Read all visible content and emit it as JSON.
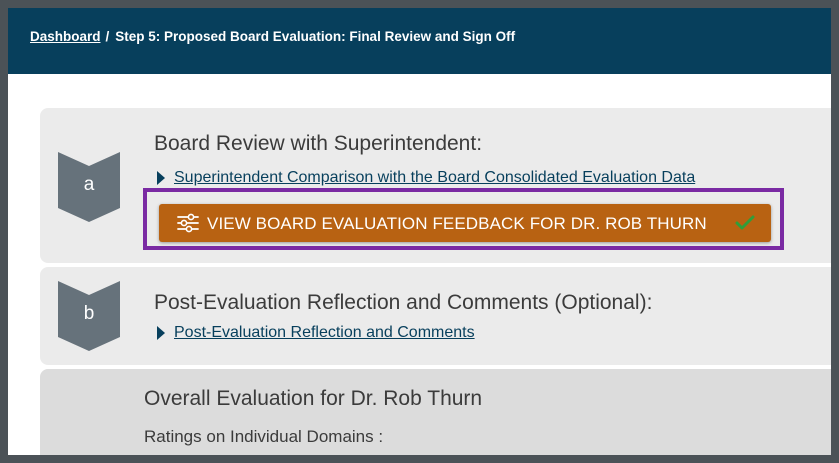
{
  "breadcrumb": {
    "home": "Dashboard",
    "separator": "/",
    "current": "Step 5: Proposed Board Evaluation: Final Review and Sign Off"
  },
  "sections": [
    {
      "badge": "a",
      "title": "Board Review with Superintendent:",
      "link": "Superintendent Comparison with the Board Consolidated Evaluation Data",
      "button": "VIEW BOARD EVALUATION FEEDBACK FOR DR. ROB THURN",
      "button_icon": "sliders-icon",
      "button_status_icon": "check-icon"
    },
    {
      "badge": "b",
      "title": "Post-Evaluation Reflection and Comments (Optional):",
      "link": "Post-Evaluation Reflection and Comments"
    },
    {
      "title": "Overall Evaluation for Dr. Rob Thurn",
      "subtitle": "Ratings on Individual Domains :"
    }
  ],
  "colors": {
    "header": "#073f5c",
    "button": "#b86212",
    "highlight": "#7a2aa3",
    "check": "#2f9e3a"
  }
}
